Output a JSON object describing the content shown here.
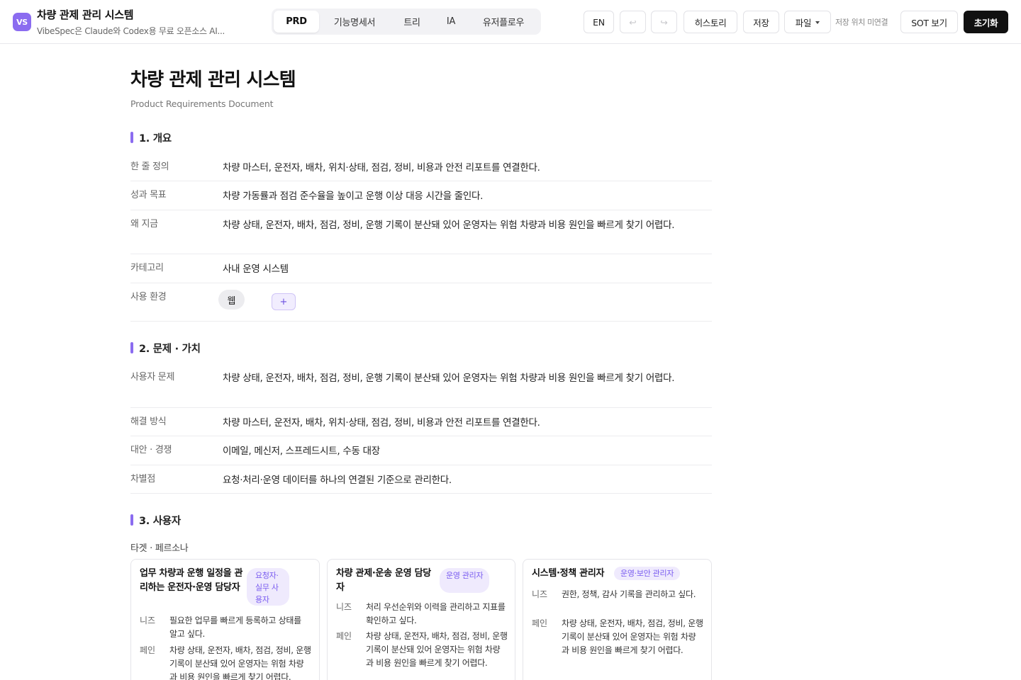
{
  "app": {
    "logo_text": "VS",
    "title": "차량 관제 관리 시스템",
    "subtitle": "VibeSpec은 Claude와 Codex용 무료 오픈소스 AI..."
  },
  "tabs": [
    {
      "label": "PRD",
      "active": true
    },
    {
      "label": "기능명세서",
      "active": false
    },
    {
      "label": "트리",
      "active": false
    },
    {
      "label": "IA",
      "active": false
    },
    {
      "label": "유저플로우",
      "active": false
    }
  ],
  "toolbar": {
    "lang": "EN",
    "undo_icon": "↩",
    "redo_icon": "↪",
    "history": "히스토리",
    "save": "저장",
    "file": "파일",
    "save_location": "저장 위치 미연결",
    "sot": "SOT 보기",
    "reset": "초기화"
  },
  "document": {
    "title": "차량 관제 관리 시스템",
    "subtitle": "Product Requirements Document",
    "sections": {
      "overview": {
        "heading": "1. 개요",
        "rows": [
          {
            "key": "한 줄 정의",
            "value": "차량 마스터, 운전자, 배차, 위치·상태, 점검, 정비, 비용과 안전 리포트를 연결한다."
          },
          {
            "key": "성과 목표",
            "value": "차량 가동률과 점검 준수율을 높이고 운행 이상 대응 시간을 줄인다."
          },
          {
            "key": "왜 지금",
            "value": "차량 상태, 운전자, 배차, 점검, 정비, 운행 기록이 분산돼 있어 운영자는 위험 차량과 비용 원인을 빠르게 찾기 어렵다."
          },
          {
            "key": "카테고리",
            "value": "사내 운영 시스템"
          },
          {
            "key": "사용 환경",
            "value": ""
          }
        ],
        "env_chip": "웹",
        "env_add": "+"
      },
      "problem": {
        "heading": "2. 문제 · 가치",
        "rows": [
          {
            "key": "사용자 문제",
            "value": "차량 상태, 운전자, 배차, 점검, 정비, 운행 기록이 분산돼 있어 운영자는 위험 차량과 비용 원인을 빠르게 찾기 어렵다."
          },
          {
            "key": "해결 방식",
            "value": "차량 마스터, 운전자, 배차, 위치·상태, 점검, 정비, 비용과 안전 리포트를 연결한다."
          },
          {
            "key": "대안 · 경쟁",
            "value": "이메일, 메신저, 스프레드시트, 수동 대장"
          },
          {
            "key": "차별점",
            "value": "요청·처리·운영 데이터를 하나의 연결된 기준으로 관리한다."
          }
        ]
      },
      "users": {
        "heading": "3. 사용자",
        "subheading": "타겟 · 페르소나",
        "personas": [
          {
            "title": "업무 차량과 운행 일정을 관리하는 운전자·운영 담당자",
            "badge": "요청자·실무 사용자",
            "needs_label": "니즈",
            "needs": "필요한 업무를 빠르게 등록하고 상태를 알고 싶다.",
            "pain_label": "페인",
            "pain": "차량 상태, 운전자, 배차, 점검, 정비, 운행 기록이 분산돼 있어 운영자는 위험 차량과 비용 원인을 빠르게 찾기 어렵다."
          },
          {
            "title": "차량 관제·운송 운영 담당자",
            "badge": "운영 관리자",
            "needs_label": "니즈",
            "needs": "처리 우선순위와 이력을 관리하고 지표를 확인하고 싶다.",
            "pain_label": "페인",
            "pain": "차량 상태, 운전자, 배차, 점검, 정비, 운행 기록이 분산돼 있어 운영자는 위험 차량과 비용 원인을 빠르게 찾기 어렵다."
          },
          {
            "title": "시스템·정책 관리자",
            "badge": "운영·보안 관리자",
            "needs_label": "니즈",
            "needs": "권한, 정책, 감사 기록을 관리하고 싶다.",
            "pain_label": "페인",
            "pain": "차량 상태, 운전자, 배차, 점검, 정비, 운행 기록이 분산돼 있어 운영자는 위험 차량과 비용 원인을 빠르게 찾기 어렵다."
          }
        ]
      }
    }
  },
  "colors": {
    "accent": "#8b6cf0",
    "badge_bg": "#efeafd",
    "badge_text": "#7a5cf0",
    "dark_button": "#111111"
  }
}
